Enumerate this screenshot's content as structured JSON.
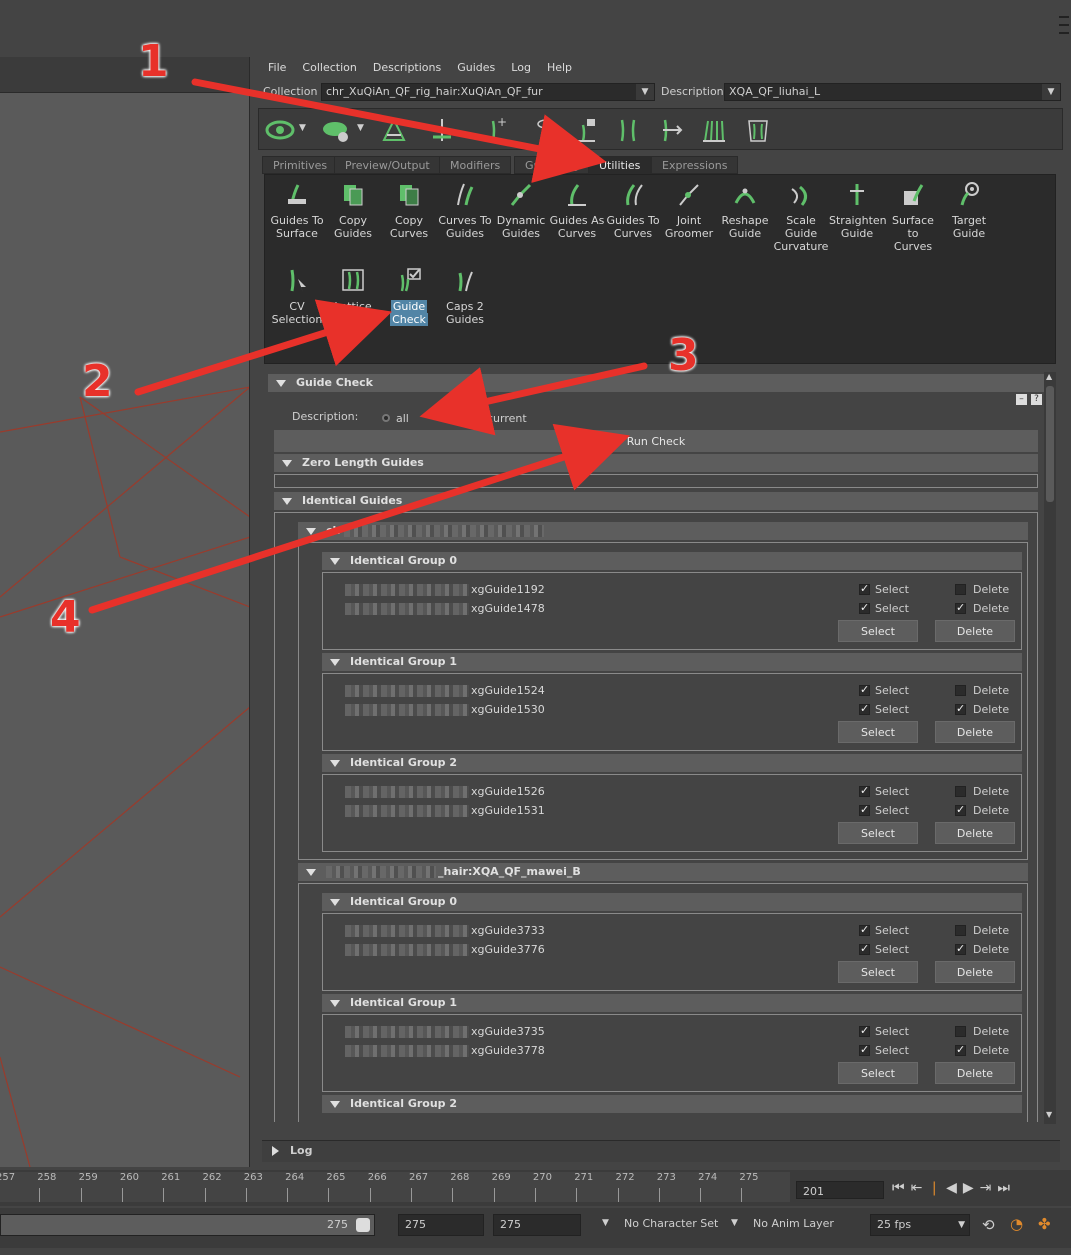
{
  "menu": [
    "File",
    "Collection",
    "Descriptions",
    "Guides",
    "Log",
    "Help"
  ],
  "collection_label": "Collection",
  "collection_value": "chr_XuQiAn_QF_rig_hair:XuQiAn_QF_fur",
  "description_label": "Description",
  "description_value": "XQA_QF_liuhai_L",
  "tabs": [
    "Primitives",
    "Preview/Output",
    "Modifiers",
    "Grooming",
    "Utilities",
    "Expressions"
  ],
  "active_tab": "Utilities",
  "tools": [
    {
      "l1": "Guides To",
      "l2": "Surface",
      "l3": ""
    },
    {
      "l1": "Copy",
      "l2": "Guides",
      "l3": ""
    },
    {
      "l1": "Copy",
      "l2": "Curves",
      "l3": ""
    },
    {
      "l1": "Curves To",
      "l2": "Guides",
      "l3": ""
    },
    {
      "l1": "Dynamic",
      "l2": "Guides",
      "l3": ""
    },
    {
      "l1": "Guides As",
      "l2": "Curves",
      "l3": ""
    },
    {
      "l1": "Guides To",
      "l2": "Curves",
      "l3": ""
    },
    {
      "l1": "Joint",
      "l2": "Groomer",
      "l3": ""
    },
    {
      "l1": "Reshape",
      "l2": "Guide",
      "l3": ""
    },
    {
      "l1": "Scale",
      "l2": "Guide",
      "l3": "Curvature"
    },
    {
      "l1": "Straighten",
      "l2": "Guide",
      "l3": ""
    },
    {
      "l1": "Surface to",
      "l2": "Curves",
      "l3": ""
    },
    {
      "l1": "Target",
      "l2": "Guide",
      "l3": ""
    },
    {
      "l1": "CV",
      "l2": "Selection",
      "l3": ""
    },
    {
      "l1": "Lattice",
      "l2": "",
      "l3": ""
    },
    {
      "l1": "Guide",
      "l2": "Check",
      "l3": ""
    },
    {
      "l1": "Caps 2",
      "l2": "Guides",
      "l3": ""
    }
  ],
  "guide_check": {
    "title": "Guide Check",
    "description_label": "Description:",
    "radio_all": "all",
    "radio_current": "current",
    "run_check": "Run Check",
    "zero_length": "Zero Length Guides",
    "identical": "Identical Guides",
    "desc1_title": "ch",
    "desc2_title": "_hair:XQA_QF_mawei_B",
    "select_label": "Select",
    "delete_label": "Delete",
    "groups1": [
      {
        "title": "Identical Group 0",
        "g1": "xgGuide1192",
        "g2": "xgGuide1478"
      },
      {
        "title": "Identical Group 1",
        "g1": "xgGuide1524",
        "g2": "xgGuide1530"
      },
      {
        "title": "Identical Group 2",
        "g1": "xgGuide1526",
        "g2": "xgGuide1531"
      }
    ],
    "groups2": [
      {
        "title": "Identical Group 0",
        "g1": "xgGuide3733",
        "g2": "xgGuide3776"
      },
      {
        "title": "Identical Group 1",
        "g1": "xgGuide3735",
        "g2": "xgGuide3778"
      },
      {
        "title": "Identical Group 2"
      }
    ]
  },
  "log_label": "Log",
  "ruler": [
    "257",
    "258",
    "259",
    "260",
    "261",
    "262",
    "263",
    "264",
    "265",
    "266",
    "267",
    "268",
    "269",
    "270",
    "271",
    "272",
    "273",
    "274",
    "275"
  ],
  "current_frame": "201",
  "range_end": "275",
  "end_field1": "275",
  "end_field2": "275",
  "character_set": "No Character Set",
  "anim_layer": "No Anim Layer",
  "fps": "25 fps",
  "annotations": [
    "1",
    "2",
    "3",
    "4"
  ],
  "colors": {
    "accent": "#5285a6",
    "annotation": "#e8312a",
    "icon_green": "#5fbf6a"
  }
}
